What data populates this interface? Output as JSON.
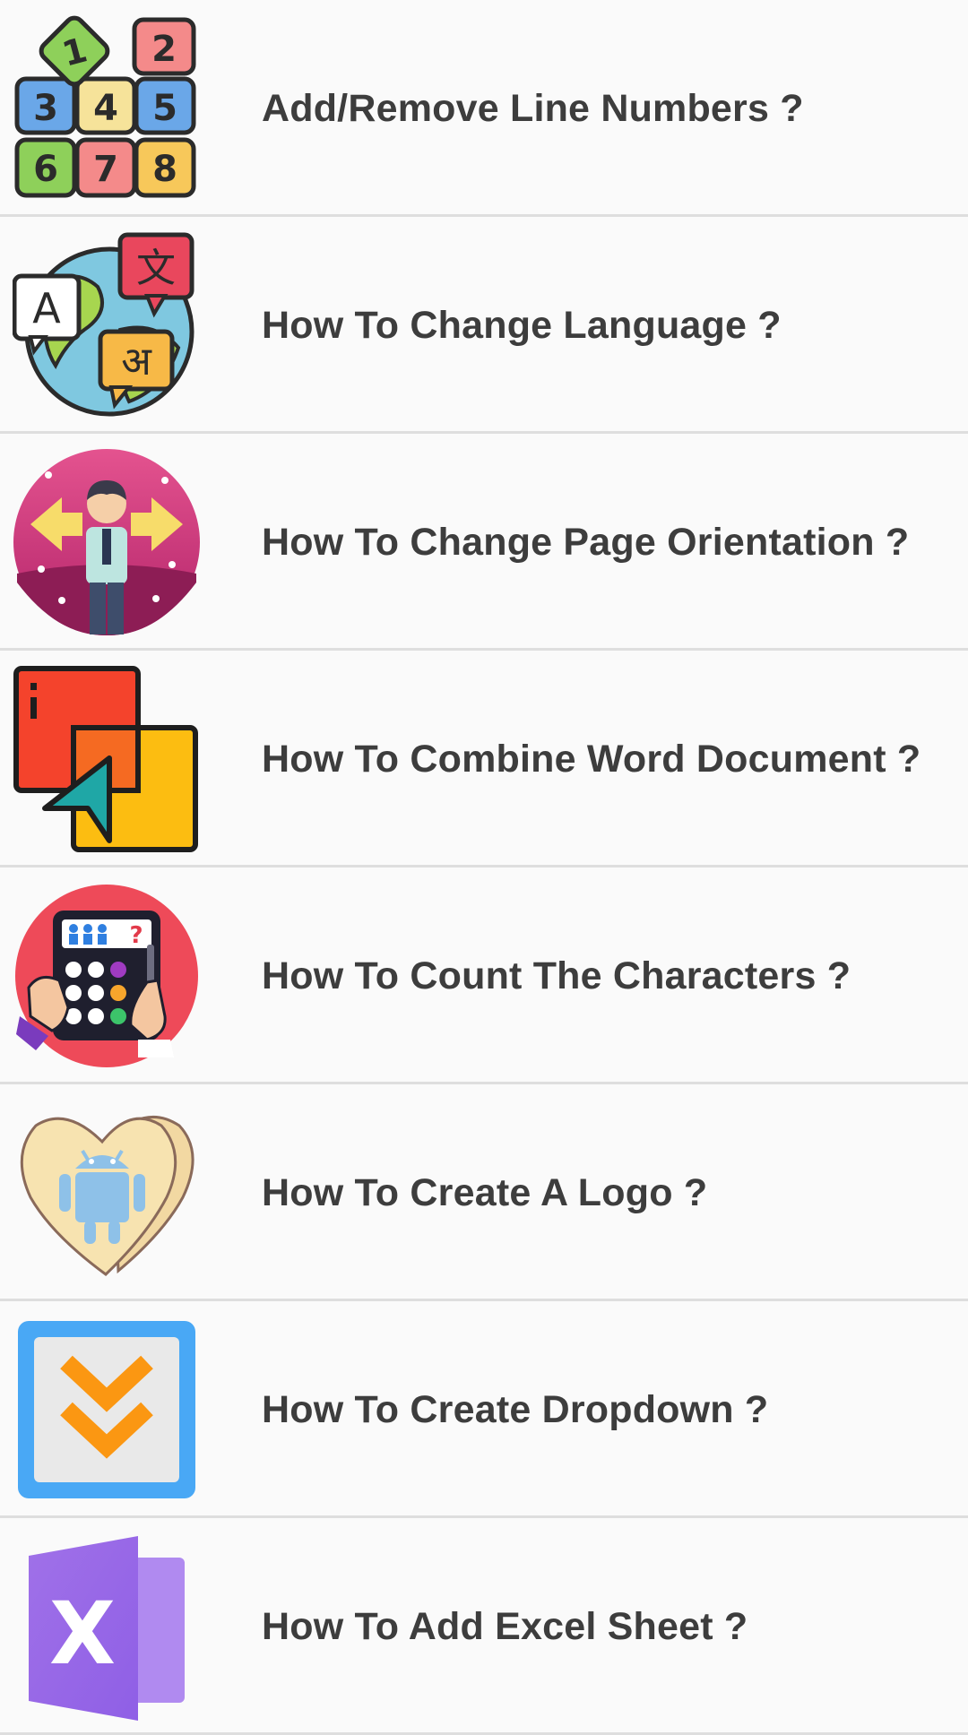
{
  "list": {
    "items": [
      {
        "label": "Add/Remove Line Numbers ?",
        "icon": "number-blocks-icon"
      },
      {
        "label": "How To Change Language ?",
        "icon": "globe-translate-icon"
      },
      {
        "label": "How To Change Page Orientation ?",
        "icon": "person-arrows-icon"
      },
      {
        "label": "How To Combine Word Document ?",
        "icon": "overlapping-squares-cursor-icon"
      },
      {
        "label": "How To Count The Characters ?",
        "icon": "calculator-hands-icon"
      },
      {
        "label": "How To Create A Logo ?",
        "icon": "heart-android-icon"
      },
      {
        "label": "How To Create Dropdown ?",
        "icon": "double-chevron-down-icon"
      },
      {
        "label": "How To Add Excel Sheet ?",
        "icon": "excel-icon"
      }
    ]
  },
  "icons": {
    "number_blocks": {
      "d1": "1",
      "d2": "2",
      "d3": "3",
      "d4": "4",
      "d5": "5",
      "d6": "6",
      "d7": "7",
      "d8": "8"
    },
    "translate": {
      "a": "A",
      "zh": "文",
      "hi": "अ"
    },
    "calculator": {
      "q": "?"
    },
    "excel": {
      "x": "X"
    }
  },
  "colors": {
    "text": "#3d3d3d",
    "divider": "#dedede",
    "row_bg": "#fafafa"
  }
}
